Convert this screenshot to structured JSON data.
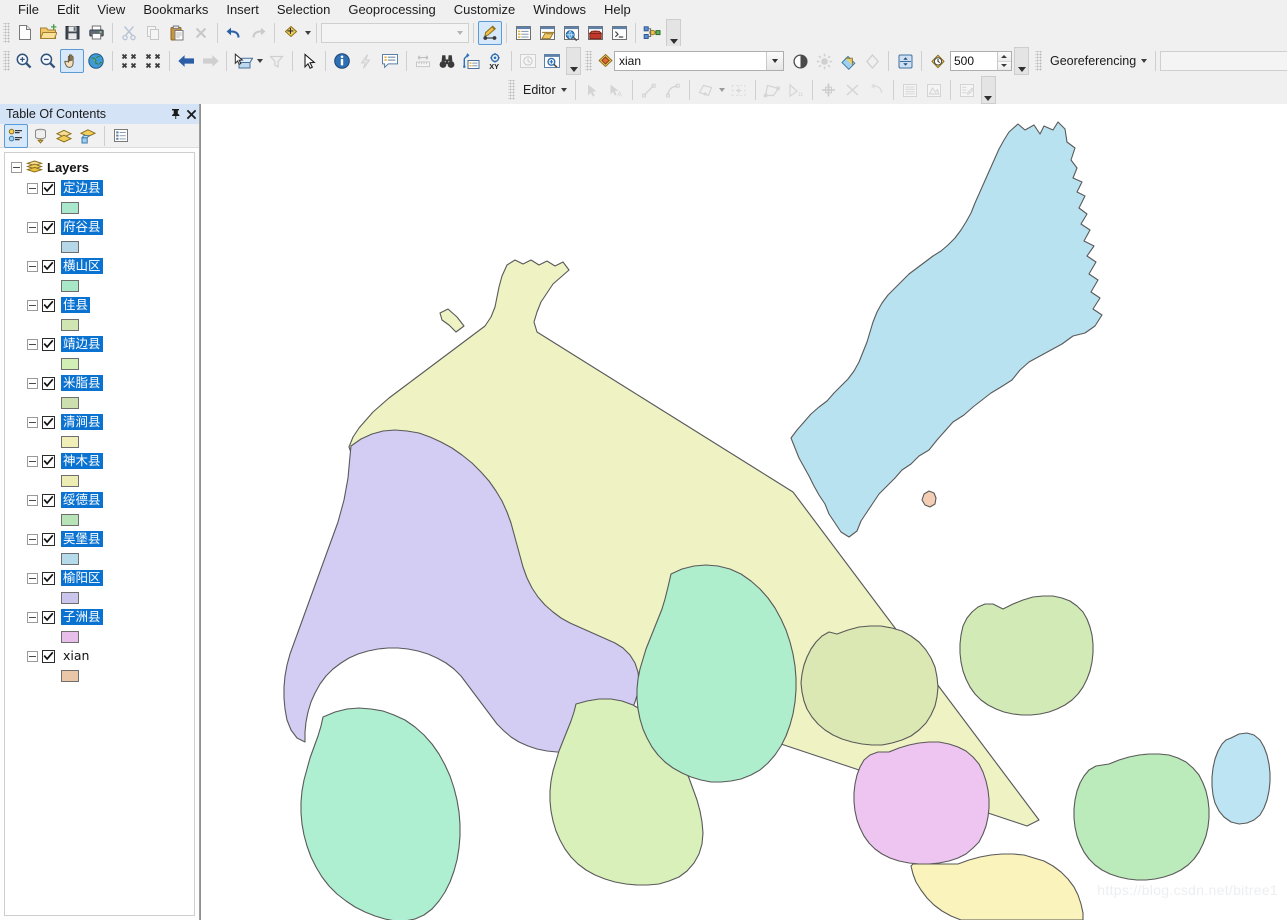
{
  "window": {
    "title": "ArcMap"
  },
  "menubar": {
    "items": [
      {
        "label": "File",
        "name": "menu-file"
      },
      {
        "label": "Edit",
        "name": "menu-edit"
      },
      {
        "label": "View",
        "name": "menu-view"
      },
      {
        "label": "Bookmarks",
        "name": "menu-bookmarks"
      },
      {
        "label": "Insert",
        "name": "menu-insert"
      },
      {
        "label": "Selection",
        "name": "menu-selection"
      },
      {
        "label": "Geoprocessing",
        "name": "menu-geoprocessing"
      },
      {
        "label": "Customize",
        "name": "menu-customize"
      },
      {
        "label": "Windows",
        "name": "menu-windows"
      },
      {
        "label": "Help",
        "name": "menu-help"
      }
    ]
  },
  "standard_toolbar": {
    "scale_value": "",
    "scale_placeholder": "",
    "buttons": [
      {
        "name": "new-map-file-icon",
        "title": "New"
      },
      {
        "name": "open-folder-icon",
        "title": "Open"
      },
      {
        "name": "save-floppy-icon",
        "title": "Save"
      },
      {
        "name": "print-icon",
        "title": "Print"
      },
      {
        "name": "cut-scissors-icon",
        "title": "Cut"
      },
      {
        "name": "copy-icon",
        "title": "Copy"
      },
      {
        "name": "paste-icon",
        "title": "Paste"
      },
      {
        "name": "delete-x-icon",
        "title": "Delete"
      },
      {
        "name": "undo-arrow-icon",
        "title": "Undo"
      },
      {
        "name": "redo-arrow-icon",
        "title": "Redo"
      },
      {
        "name": "add-data-icon",
        "title": "Add Data"
      },
      {
        "name": "editor-toolbar-icon",
        "title": "Editor Toolbar"
      },
      {
        "name": "table-of-contents-icon",
        "title": "Table Of Contents"
      },
      {
        "name": "catalog-icon",
        "title": "Catalog"
      },
      {
        "name": "search-globe-icon",
        "title": "Search"
      },
      {
        "name": "arctoolbox-icon",
        "title": "ArcToolbox"
      },
      {
        "name": "python-window-icon",
        "title": "Python Window"
      },
      {
        "name": "model-builder-icon",
        "title": "ModelBuilder"
      }
    ]
  },
  "tools_toolbar": {
    "buttons": [
      {
        "name": "zoom-in-icon",
        "title": "Zoom In"
      },
      {
        "name": "zoom-out-icon",
        "title": "Zoom Out"
      },
      {
        "name": "pan-hand-icon",
        "title": "Pan"
      },
      {
        "name": "full-extent-globe-icon",
        "title": "Full Extent"
      },
      {
        "name": "fixed-zoom-in-icon",
        "title": "Fixed Zoom In"
      },
      {
        "name": "fixed-zoom-out-icon",
        "title": "Fixed Zoom Out"
      },
      {
        "name": "go-back-extent-icon",
        "title": "Go Back To Previous Extent"
      },
      {
        "name": "go-next-extent-icon",
        "title": "Go To Next Extent"
      },
      {
        "name": "select-features-icon",
        "title": "Select Features"
      },
      {
        "name": "clear-selection-icon",
        "title": "Clear Selected Features"
      },
      {
        "name": "select-elements-arrow-icon",
        "title": "Select Elements"
      },
      {
        "name": "identify-info-icon",
        "title": "Identify"
      },
      {
        "name": "hyperlink-lightning-icon",
        "title": "Hyperlink"
      },
      {
        "name": "html-popup-icon",
        "title": "HTML Popup"
      },
      {
        "name": "measure-ruler-icon",
        "title": "Measure"
      },
      {
        "name": "find-binoculars-icon",
        "title": "Find"
      },
      {
        "name": "find-route-icon",
        "title": "Find Route"
      },
      {
        "name": "go-to-xy-icon",
        "title": "Go To XY"
      },
      {
        "name": "time-slider-icon",
        "title": "Time Slider"
      },
      {
        "name": "create-viewer-window-icon",
        "title": "Create Viewer Window"
      }
    ]
  },
  "effects_toolbar": {
    "layer_select": {
      "value": "xian",
      "name": "effects-layer-select"
    },
    "transparency_value": "500",
    "buttons": [
      {
        "name": "contrast-icon",
        "title": "Contrast"
      },
      {
        "name": "brightness-icon",
        "title": "Brightness"
      },
      {
        "name": "transparency-icon",
        "title": "Transparency"
      },
      {
        "name": "swipe-icon",
        "title": "Swipe"
      },
      {
        "name": "flicker-icon",
        "title": "Flicker"
      },
      {
        "name": "flicker-rate-icon",
        "title": "Flicker Rate"
      }
    ]
  },
  "georeferencing_toolbar": {
    "menu_label": "Georeferencing",
    "layer_select_value": "",
    "buttons": [
      {
        "name": "add-control-points-icon",
        "title": "Add Control Points"
      },
      {
        "name": "auto-register-icon",
        "title": "Auto Register"
      }
    ]
  },
  "editor_toolbar": {
    "menu_label": "Editor",
    "buttons": [
      {
        "name": "edit-tool-arrow-icon",
        "title": "Edit Tool"
      },
      {
        "name": "edit-annotation-icon",
        "title": "Edit Annotation Tool"
      },
      {
        "name": "straight-segment-icon",
        "title": "Straight Segment"
      },
      {
        "name": "arc-segment-icon",
        "title": "Arc Segment"
      },
      {
        "name": "construction-tool-icon",
        "title": "Construction Tools"
      },
      {
        "name": "mid-point-icon",
        "title": "Midpoint"
      },
      {
        "name": "trace-icon",
        "title": "Trace"
      },
      {
        "name": "split-tool-icon",
        "title": "Split Tool"
      },
      {
        "name": "rotate-tool-icon",
        "title": "Rotate Tool"
      },
      {
        "name": "cut-polygons-icon",
        "title": "Cut Polygons Tool"
      },
      {
        "name": "reshape-feature-icon",
        "title": "Reshape Feature Tool"
      },
      {
        "name": "attributes-table-icon",
        "title": "Attributes"
      },
      {
        "name": "sketch-properties-icon",
        "title": "Sketch Properties"
      },
      {
        "name": "create-features-icon",
        "title": "Create Features"
      }
    ]
  },
  "table_of_contents": {
    "title": "Table Of Contents",
    "pin_icon": "pin-icon",
    "close_icon": "close-icon",
    "tool_buttons": [
      {
        "name": "list-by-drawing-order-icon",
        "title": "List By Drawing Order"
      },
      {
        "name": "list-by-source-icon",
        "title": "List By Source"
      },
      {
        "name": "list-by-visibility-icon",
        "title": "List By Visibility"
      },
      {
        "name": "list-by-selection-icon",
        "title": "List By Selection"
      },
      {
        "name": "toc-options-icon",
        "title": "Options"
      }
    ],
    "root_label": "Layers",
    "layers": [
      {
        "label": "定边县",
        "checked": true,
        "selected": true,
        "swatch": "#a9e8cc"
      },
      {
        "label": "府谷县",
        "checked": true,
        "selected": true,
        "swatch": "#b6d7e8"
      },
      {
        "label": "横山区",
        "checked": true,
        "selected": true,
        "swatch": "#a9e8c6"
      },
      {
        "label": "佳县",
        "checked": true,
        "selected": true,
        "swatch": "#cfe6b2"
      },
      {
        "label": "靖边县",
        "checked": true,
        "selected": true,
        "swatch": "#d2efb5"
      },
      {
        "label": "米脂县",
        "checked": true,
        "selected": true,
        "swatch": "#ccdfae"
      },
      {
        "label": "清涧县",
        "checked": true,
        "selected": true,
        "swatch": "#f2eeb8"
      },
      {
        "label": "神木县",
        "checked": true,
        "selected": true,
        "swatch": "#edecb2"
      },
      {
        "label": "绥德县",
        "checked": true,
        "selected": true,
        "swatch": "#b8e3b6"
      },
      {
        "label": "吴堡县",
        "checked": true,
        "selected": true,
        "swatch": "#b5dbea"
      },
      {
        "label": "榆阳区",
        "checked": true,
        "selected": true,
        "swatch": "#cac5ec"
      },
      {
        "label": "子洲县",
        "checked": true,
        "selected": true,
        "swatch": "#e7bde9"
      },
      {
        "label": "xian",
        "checked": true,
        "selected": false,
        "swatch": "#eac6a8"
      }
    ]
  },
  "map": {
    "watermark": "https://blog.csdn.net/bitree1",
    "background": "#ffffff",
    "stroke": "#595959",
    "regions": [
      {
        "name": "dingbian",
        "label": "定边县",
        "fill": "#aeeed1"
      },
      {
        "name": "jingbian",
        "label": "靖边县",
        "fill": "#d9f0bb"
      },
      {
        "name": "hengshan",
        "label": "横山区",
        "fill": "#aeeecd"
      },
      {
        "name": "yuyang",
        "label": "榆阳区",
        "fill": "#d3cdf4"
      },
      {
        "name": "shenmu",
        "label": "神木县",
        "fill": "#eff2c3"
      },
      {
        "name": "fugu",
        "label": "府谷县",
        "fill": "#b9e2f0"
      },
      {
        "name": "mizhi",
        "label": "米脂县",
        "fill": "#dbe8b4"
      },
      {
        "name": "jiaxian",
        "label": "佳县",
        "fill": "#d2eab5"
      },
      {
        "name": "zizhou",
        "label": "子洲县",
        "fill": "#eec5f0"
      },
      {
        "name": "suide",
        "label": "绥德县",
        "fill": "#bbeabb"
      },
      {
        "name": "wubu",
        "label": "吴堡县",
        "fill": "#bde4f3"
      },
      {
        "name": "qingjian",
        "label": "清涧县",
        "fill": "#faf3bc"
      },
      {
        "name": "xian-small",
        "label": "xian",
        "fill": "#f3cdb4"
      }
    ]
  }
}
